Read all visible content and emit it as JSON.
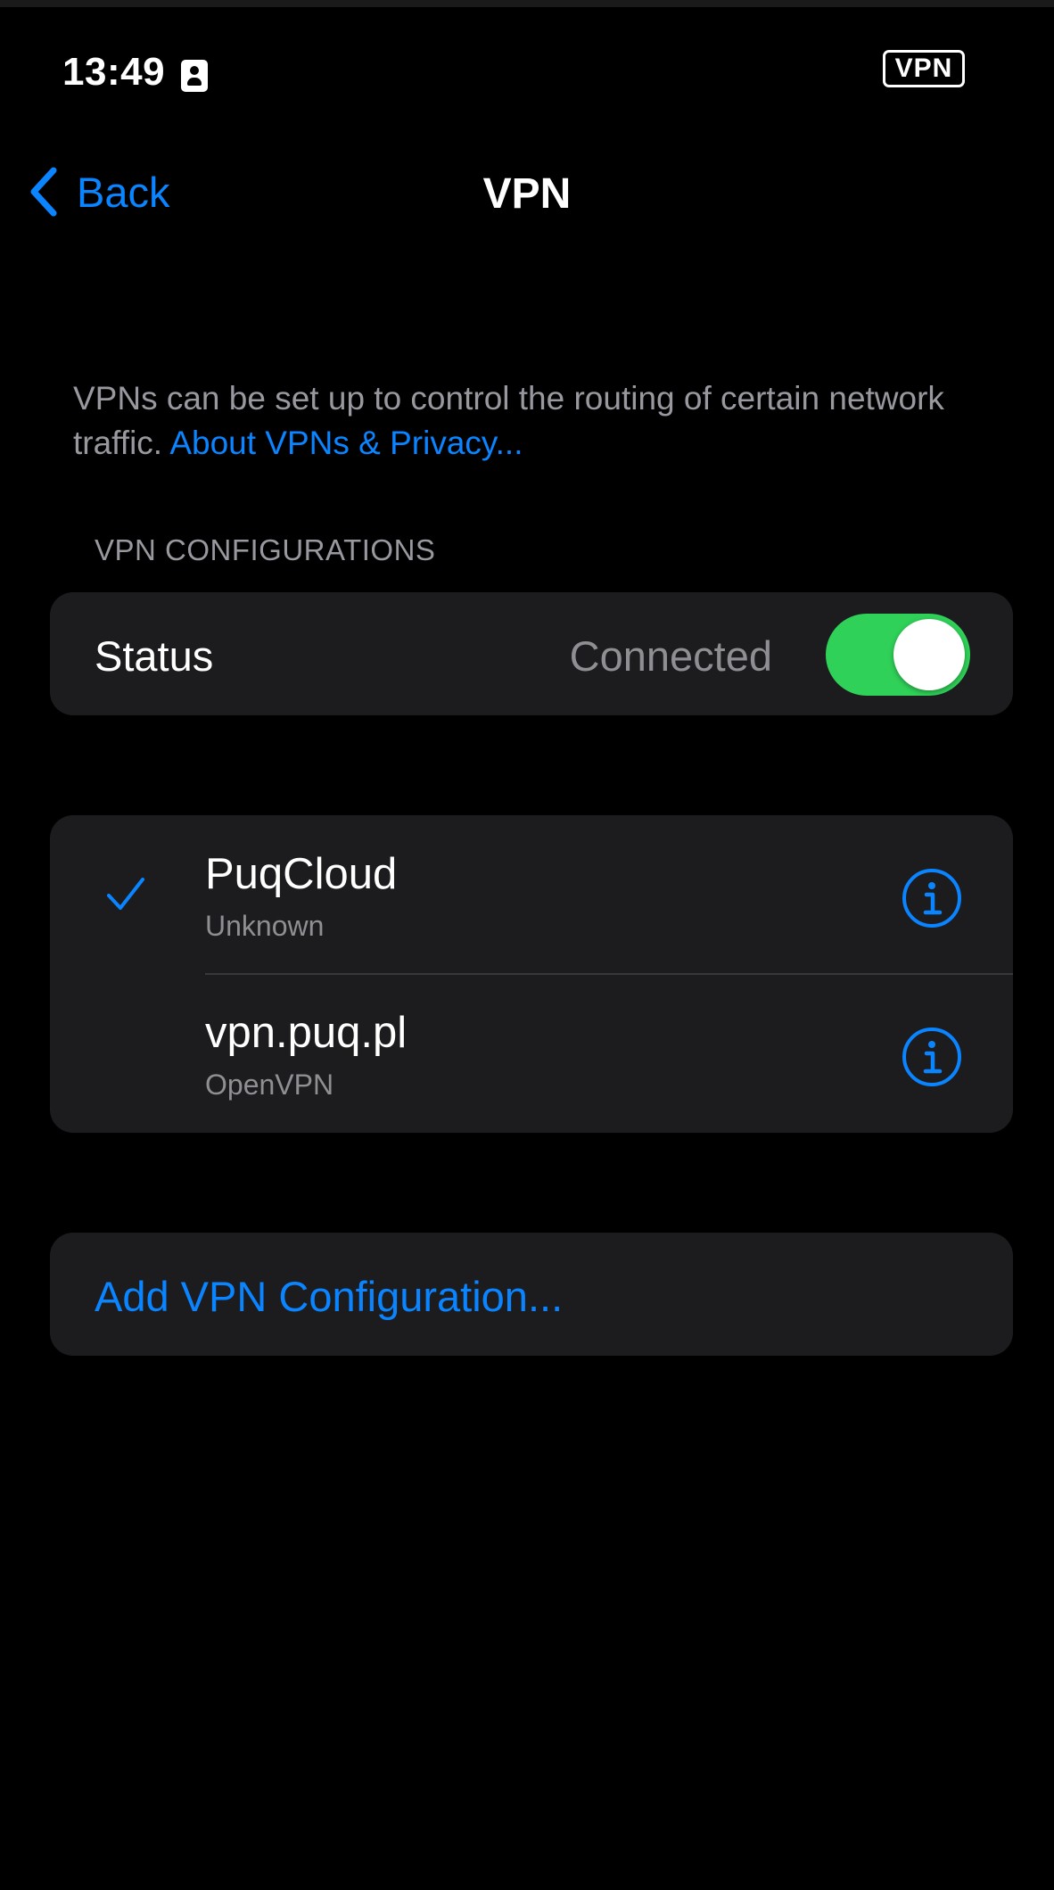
{
  "status_bar": {
    "time": "13:49",
    "id_icon": "contact-card-icon",
    "vpn_badge": "VPN"
  },
  "nav": {
    "back_label": "Back",
    "back_icon": "chevron-left-icon",
    "title": "VPN"
  },
  "description": {
    "text": "VPNs can be set up to control the routing of certain network traffic. ",
    "link_text": "About VPNs & Privacy..."
  },
  "section_header": "VPN CONFIGURATIONS",
  "status_row": {
    "label": "Status",
    "value": "Connected",
    "toggle_on": true
  },
  "configurations": [
    {
      "name": "PuqCloud",
      "type": "Unknown",
      "selected": true,
      "info_icon": "info-circle-icon"
    },
    {
      "name": "vpn.puq.pl",
      "type": "OpenVPN",
      "selected": false,
      "info_icon": "info-circle-icon"
    }
  ],
  "add_configuration_label": "Add VPN Configuration...",
  "colors": {
    "accent": "#0a84ff",
    "toggle_on": "#30d158",
    "background": "#000000",
    "group_background": "#1c1c1e",
    "secondary_text": "#8e8e93"
  }
}
